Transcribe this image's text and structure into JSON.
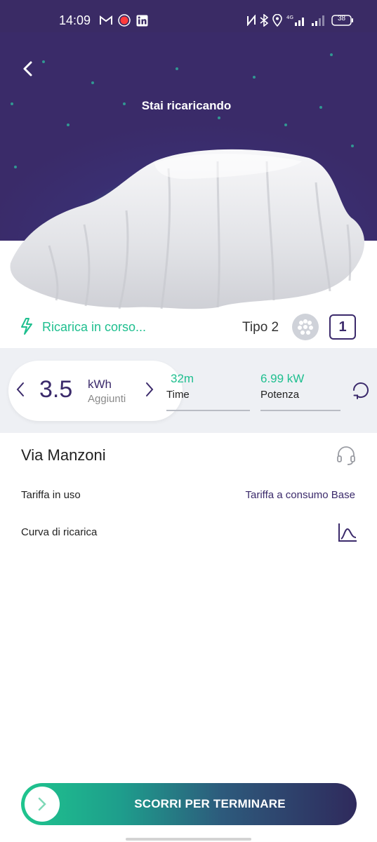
{
  "status_bar": {
    "time": "14:09",
    "battery": "38",
    "network": "4G"
  },
  "header": {
    "title": "Stai ricaricando"
  },
  "charging": {
    "status_label": "Ricarica in corso...",
    "connector_type": "Tipo 2",
    "port_number": "1"
  },
  "stats": {
    "energy_value": "3.5",
    "energy_unit": "kWh",
    "energy_sub": "Aggiunti",
    "time_value": "32m",
    "time_label": "Time",
    "power_value": "6.99 kW",
    "power_label": "Potenza"
  },
  "station": {
    "name": "Via Manzoni",
    "tariff_label": "Tariffa in uso",
    "tariff_value": "Tariffa a consumo Base",
    "curve_label": "Curva di ricarica"
  },
  "slider": {
    "label": "SCORRI PER TERMINARE"
  },
  "colors": {
    "accent": "#1fbf8f",
    "brand_purple": "#3b2a6b",
    "header_bg": "#3a2b65"
  },
  "icons": [
    "back-icon",
    "bolt-icon",
    "connector-type2-icon",
    "chevron-left-icon",
    "chevron-right-icon",
    "refresh-icon",
    "headset-icon",
    "chart-curve-icon",
    "chevron-right-icon"
  ]
}
